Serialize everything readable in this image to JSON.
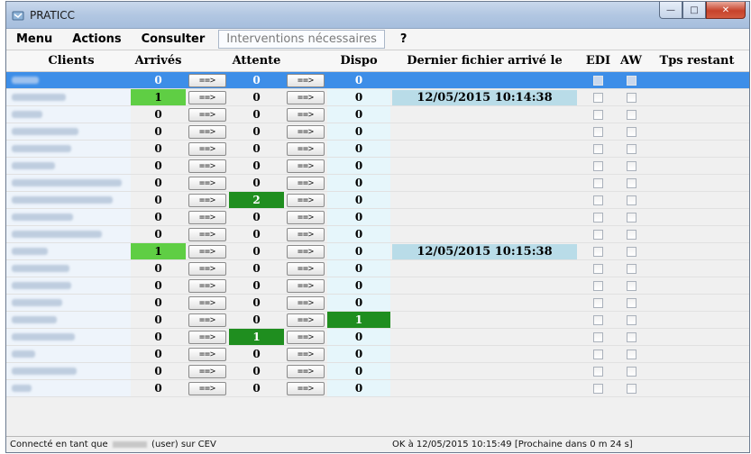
{
  "window": {
    "title": "PRATICC"
  },
  "menu": {
    "items": [
      "Menu",
      "Actions",
      "Consulter"
    ],
    "boxed": "Interventions nécessaires",
    "help": "?"
  },
  "columns": {
    "clients": "Clients",
    "arrives": "Arrivés",
    "attente": "Attente",
    "dispo": "Dispo",
    "dernier": "Dernier fichier arrivé le",
    "edi": "EDI",
    "aw": "AW",
    "tps": "Tps restant"
  },
  "button_label": "==>",
  "rows": [
    {
      "arr": "0",
      "att": "0",
      "disp": "0",
      "date": "",
      "selected": true,
      "arr_hl": "",
      "att_hl": "",
      "disp_hl": "",
      "w": 30
    },
    {
      "arr": "1",
      "att": "0",
      "disp": "0",
      "date": "12/05/2015 10:14:38",
      "arr_hl": "lightgreen",
      "att_hl": "",
      "disp_hl": "",
      "w": 60
    },
    {
      "arr": "0",
      "att": "0",
      "disp": "0",
      "date": "",
      "arr_hl": "",
      "att_hl": "",
      "disp_hl": "",
      "w": 34
    },
    {
      "arr": "0",
      "att": "0",
      "disp": "0",
      "date": "",
      "arr_hl": "",
      "att_hl": "",
      "disp_hl": "",
      "w": 74
    },
    {
      "arr": "0",
      "att": "0",
      "disp": "0",
      "date": "",
      "arr_hl": "",
      "att_hl": "",
      "disp_hl": "",
      "w": 66
    },
    {
      "arr": "0",
      "att": "0",
      "disp": "0",
      "date": "",
      "arr_hl": "",
      "att_hl": "",
      "disp_hl": "",
      "w": 48
    },
    {
      "arr": "0",
      "att": "0",
      "disp": "0",
      "date": "",
      "arr_hl": "",
      "att_hl": "",
      "disp_hl": "",
      "w": 122
    },
    {
      "arr": "0",
      "att": "2",
      "disp": "0",
      "date": "",
      "arr_hl": "",
      "att_hl": "darkgreen",
      "disp_hl": "",
      "w": 112
    },
    {
      "arr": "0",
      "att": "0",
      "disp": "0",
      "date": "",
      "arr_hl": "",
      "att_hl": "",
      "disp_hl": "",
      "w": 68
    },
    {
      "arr": "0",
      "att": "0",
      "disp": "0",
      "date": "",
      "arr_hl": "",
      "att_hl": "",
      "disp_hl": "",
      "w": 100
    },
    {
      "arr": "1",
      "att": "0",
      "disp": "0",
      "date": "12/05/2015 10:15:38",
      "arr_hl": "lightgreen",
      "att_hl": "",
      "disp_hl": "",
      "w": 40
    },
    {
      "arr": "0",
      "att": "0",
      "disp": "0",
      "date": "",
      "arr_hl": "",
      "att_hl": "",
      "disp_hl": "",
      "w": 64
    },
    {
      "arr": "0",
      "att": "0",
      "disp": "0",
      "date": "",
      "arr_hl": "",
      "att_hl": "",
      "disp_hl": "",
      "w": 66
    },
    {
      "arr": "0",
      "att": "0",
      "disp": "0",
      "date": "",
      "arr_hl": "",
      "att_hl": "",
      "disp_hl": "",
      "w": 56
    },
    {
      "arr": "0",
      "att": "0",
      "disp": "1",
      "date": "",
      "arr_hl": "",
      "att_hl": "",
      "disp_hl": "darkgreen",
      "w": 50
    },
    {
      "arr": "0",
      "att": "1",
      "disp": "0",
      "date": "",
      "arr_hl": "",
      "att_hl": "darkgreen",
      "disp_hl": "",
      "w": 70
    },
    {
      "arr": "0",
      "att": "0",
      "disp": "0",
      "date": "",
      "arr_hl": "",
      "att_hl": "",
      "disp_hl": "",
      "w": 26
    },
    {
      "arr": "0",
      "att": "0",
      "disp": "0",
      "date": "",
      "arr_hl": "",
      "att_hl": "",
      "disp_hl": "",
      "w": 72
    },
    {
      "arr": "0",
      "att": "0",
      "disp": "0",
      "date": "",
      "arr_hl": "",
      "att_hl": "",
      "disp_hl": "",
      "w": 22
    }
  ],
  "status": {
    "left_prefix": "Connecté en tant que",
    "left_suffix": "(user) sur CEV",
    "right": "OK à 12/05/2015 10:15:49 [Prochaine dans 0 m 24 s]"
  },
  "colors": {
    "selected": "#3d8ee8",
    "lightgreen": "#5fce44",
    "darkgreen": "#1f8e1f",
    "date_bg": "#b9dce8"
  }
}
